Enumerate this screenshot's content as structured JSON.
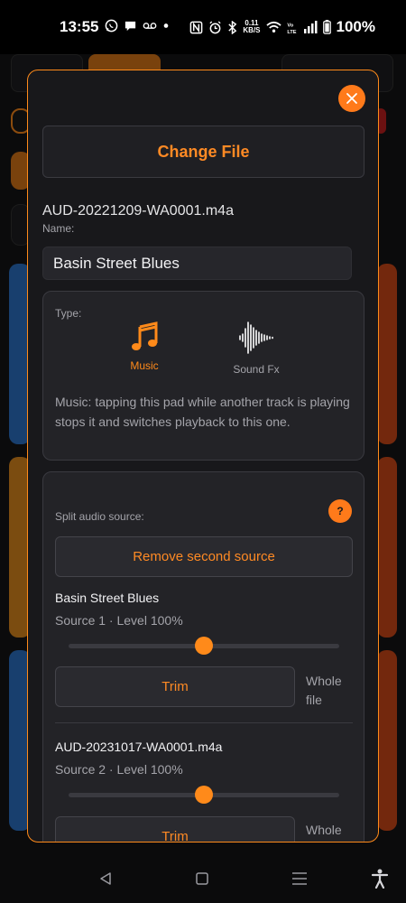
{
  "status_bar": {
    "time": "13:55",
    "net_speed_value": "0.11",
    "net_speed_unit": "KB/S",
    "battery": "100%"
  },
  "modal": {
    "close_icon": "close-icon",
    "change_file_label": "Change File",
    "file_name": "AUD-20221209-WA0001.m4a",
    "name_label": "Name:",
    "name_value": "Basin Street Blues",
    "type": {
      "label": "Type:",
      "options": [
        {
          "label": "Music",
          "icon": "music-note-icon",
          "selected": true
        },
        {
          "label": "Sound Fx",
          "icon": "waveform-icon",
          "selected": false
        }
      ],
      "description": "Music: tapping this pad while another track is playing stops it and switches playback to this one."
    },
    "split": {
      "label": "Split audio source:",
      "help_label": "?",
      "remove_label": "Remove second source",
      "sources": [
        {
          "title": "Basin Street Blues",
          "subtitle": "Source 1 · Level 100%",
          "level": 0.5,
          "trim_label": "Trim",
          "range_label": "Whole file"
        },
        {
          "title": "AUD-20231017-WA0001.m4a",
          "subtitle": "Source 2 · Level 100%",
          "level": 0.5,
          "trim_label": "Trim",
          "range_label": "Whole file"
        }
      ]
    }
  },
  "colors": {
    "accent": "#ff8a1a",
    "modal_bg": "#18181b",
    "card_bg": "#232327"
  },
  "nav_bar": {
    "items": [
      "back-icon",
      "home-icon",
      "recents-icon",
      "accessibility-icon"
    ]
  }
}
